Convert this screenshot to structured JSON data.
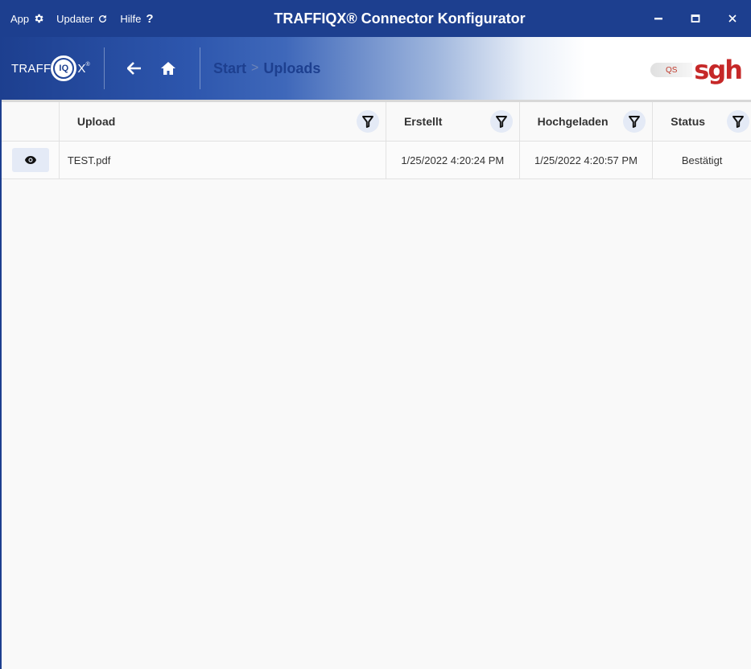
{
  "titlebar": {
    "menu": [
      {
        "label": "App",
        "icon": "gear-icon"
      },
      {
        "label": "Updater",
        "icon": "refresh-icon"
      },
      {
        "label": "Hilfe",
        "icon": "question-icon"
      }
    ],
    "title": "TRAFFIQX® Connector Konfigurator",
    "color": "#1d3f8f"
  },
  "header": {
    "logo_text": "TRAFF",
    "logo_circle": "IQ",
    "logo_tail": "X",
    "logo_mark": "®",
    "breadcrumb": {
      "root": "Start",
      "separator": ">",
      "current": "Uploads"
    },
    "brand_badge": "QS",
    "brand_logo": "sgh"
  },
  "table": {
    "columns": [
      "Upload",
      "Erstellt",
      "Hochgeladen",
      "Status"
    ],
    "rows": [
      {
        "upload": "TEST.pdf",
        "erstellt": "1/25/2022 4:20:24 PM",
        "hochgeladen": "1/25/2022 4:20:57 PM",
        "status": "Bestätigt"
      }
    ]
  }
}
